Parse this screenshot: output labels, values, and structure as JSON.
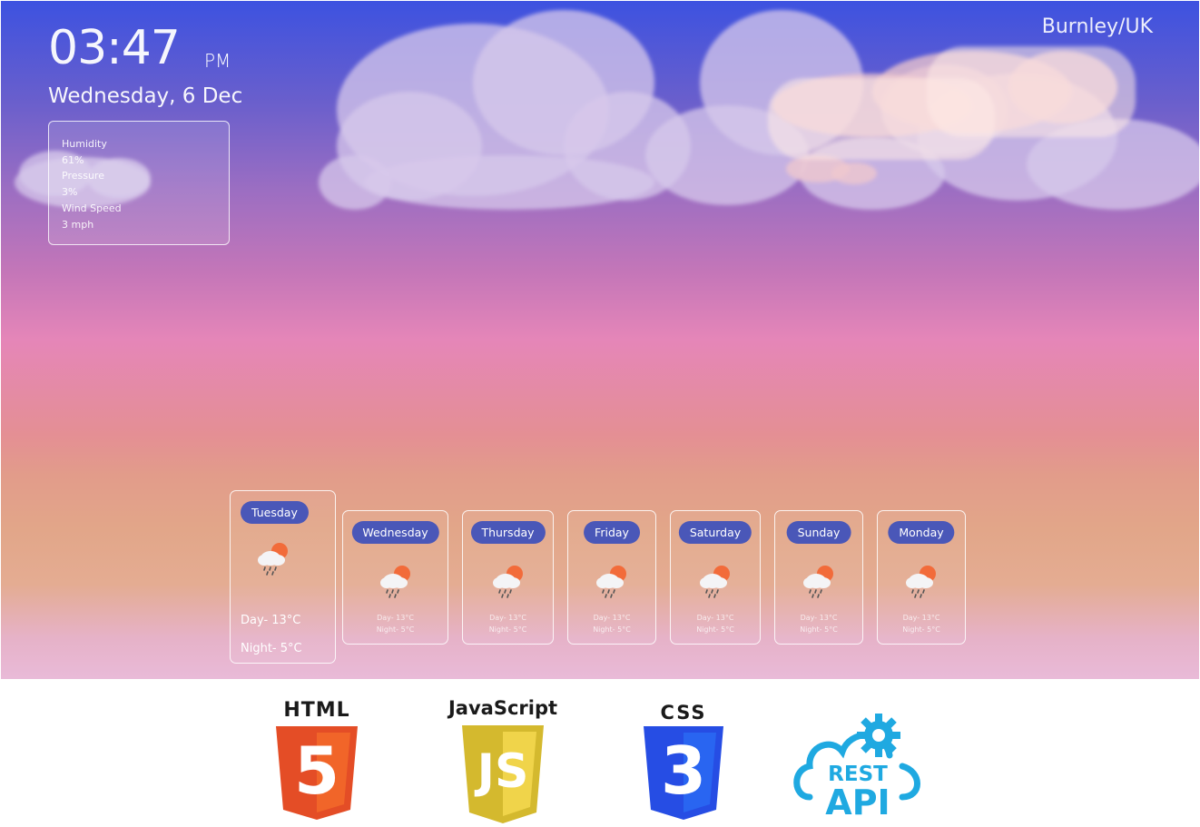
{
  "clock": {
    "time": "03:47",
    "ampm": "PM"
  },
  "date": "Wednesday, 6 Dec",
  "location": "Burnley/UK",
  "stats": {
    "humidity_label": "Humidity",
    "humidity_value": "61%",
    "pressure_label": "Pressure",
    "pressure_value": "3%",
    "wind_label": "Wind Speed",
    "wind_value": "3 mph"
  },
  "forecast": [
    {
      "day": "Tuesday",
      "day_temp": "Day- 13°C",
      "night_temp": "Night- 5°C",
      "icon": "rain-cloud-sun-icon"
    },
    {
      "day": "Wednesday",
      "day_temp": "Day- 13°C",
      "night_temp": "Night- 5°C",
      "icon": "rain-cloud-sun-icon"
    },
    {
      "day": "Thursday",
      "day_temp": "Day- 13°C",
      "night_temp": "Night- 5°C",
      "icon": "rain-cloud-sun-icon"
    },
    {
      "day": "Friday",
      "day_temp": "Day- 13°C",
      "night_temp": "Night- 5°C",
      "icon": "rain-cloud-sun-icon"
    },
    {
      "day": "Saturday",
      "day_temp": "Day- 13°C",
      "night_temp": "Night- 5°C",
      "icon": "rain-cloud-sun-icon"
    },
    {
      "day": "Sunday",
      "day_temp": "Day- 13°C",
      "night_temp": "Night- 5°C",
      "icon": "rain-cloud-sun-icon"
    },
    {
      "day": "Monday",
      "day_temp": "Day- 13°C",
      "night_temp": "Night- 5°C",
      "icon": "rain-cloud-sun-icon"
    }
  ],
  "tech_logos": {
    "html": "HTML",
    "html_num": "5",
    "js": "JavaScript",
    "js_mark": "JS",
    "css": "CSS",
    "css_num": "3",
    "api_top": "REST",
    "api_bottom": "API"
  },
  "colors": {
    "pill": "#4a57b8",
    "html": "#e44d26",
    "js": "#f0d44a",
    "css": "#264de4",
    "api": "#1fa9e1"
  }
}
